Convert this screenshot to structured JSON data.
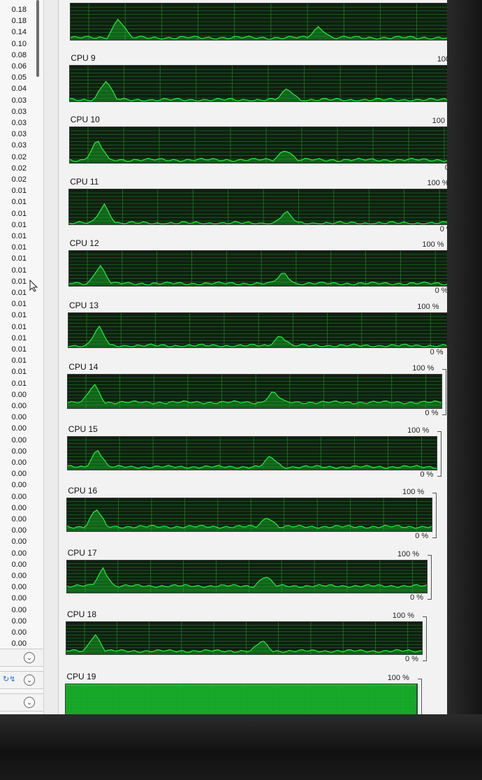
{
  "left_values": [
    "0.18",
    "0.18",
    "0.14",
    "0.10",
    "0.08",
    "0.06",
    "0.05",
    "0.04",
    "0.03",
    "0.03",
    "0.03",
    "0.03",
    "0.03",
    "0.02",
    "0.02",
    "0.02",
    "0.01",
    "0.01",
    "0.01",
    "0.01",
    "0.01",
    "0.01",
    "0.01",
    "0.01",
    "0.01",
    "0.01",
    "0.01",
    "0.01",
    "0.01",
    "0.01",
    "0.01",
    "0.01",
    "0.01",
    "0.01",
    "0.00",
    "0.00",
    "0.00",
    "0.00",
    "0.00",
    "0.00",
    "0.00",
    "0.00",
    "0.00",
    "0.00",
    "0.00",
    "0.00",
    "0.00",
    "0.00",
    "0.00",
    "0.00",
    "0.00",
    "0.00",
    "0.00",
    "0.00",
    "0.00",
    "0.00",
    "0.00",
    "0.00"
  ],
  "percent_max": "100 %",
  "percent_min": "0 %",
  "cpus": [
    {
      "label": "",
      "fill": 0.06,
      "spikes": [
        0.12,
        0.62
      ]
    },
    {
      "label": "CPU 9",
      "fill": 0.05,
      "spikes": [
        0.09,
        0.55
      ]
    },
    {
      "label": "CPU 10",
      "fill": 0.08,
      "spikes": [
        0.07,
        0.55
      ]
    },
    {
      "label": "CPU 11",
      "fill": 0.04,
      "spikes": [
        0.09,
        0.56
      ]
    },
    {
      "label": "CPU 12",
      "fill": 0.06,
      "spikes": [
        0.08,
        0.56
      ]
    },
    {
      "label": "CPU 13",
      "fill": 0.05,
      "spikes": [
        0.08,
        0.56
      ]
    },
    {
      "label": "CPU 14",
      "fill": 0.18,
      "spikes": [
        0.07,
        0.55
      ]
    },
    {
      "label": "CPU 15",
      "fill": 0.1,
      "spikes": [
        0.08,
        0.55
      ]
    },
    {
      "label": "CPU 16",
      "fill": 0.14,
      "spikes": [
        0.08,
        0.55
      ]
    },
    {
      "label": "CPU 17",
      "fill": 0.22,
      "spikes": [
        0.1,
        0.55
      ]
    },
    {
      "label": "CPU 18",
      "fill": 0.1,
      "spikes": [
        0.08,
        0.55
      ]
    },
    {
      "label": "CPU 19",
      "fill": 1.0,
      "spikes": []
    }
  ],
  "icons": {
    "chevron": "chevron-down-icon",
    "toolbar": "refresh-icon",
    "cursor": "mouse-pointer-icon"
  },
  "colors": {
    "graph_bg": "#0f1f10",
    "grid": "#1f7a24",
    "line": "#21e63a",
    "fill": "#17b52b"
  }
}
